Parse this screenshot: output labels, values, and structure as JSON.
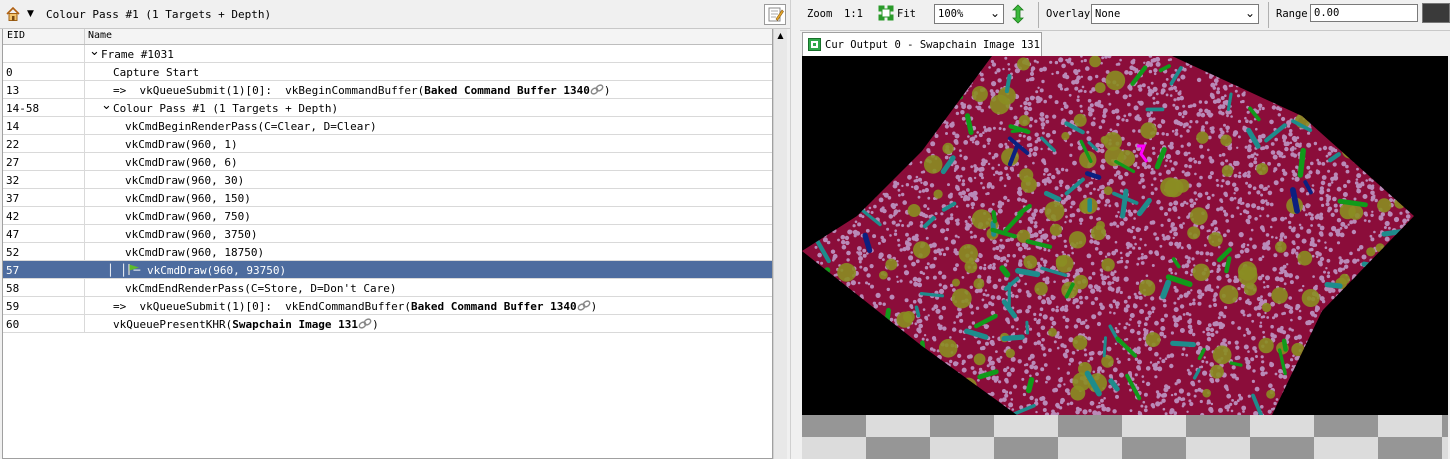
{
  "event_browser": {
    "title": "Colour Pass #1 (1 Targets + Depth)",
    "columns": {
      "eid": "EID",
      "name": "Name"
    },
    "rows": [
      {
        "eid": "",
        "name": "Frame #1031",
        "indent": 98,
        "chevron": true
      },
      {
        "eid": "0",
        "name": "Capture Start",
        "indent": 110
      },
      {
        "eid": "13",
        "name": "=>  vkQueueSubmit(1)[0]:  vkBeginCommandBuffer(",
        "bold": "Baked Command Buffer 1340",
        "tail": ")",
        "indent": 110,
        "link": true
      },
      {
        "eid": "14-58",
        "name": "Colour Pass #1 (1 Targets + Depth)",
        "indent": 110,
        "chevron": true
      },
      {
        "eid": "14",
        "name": "vkCmdBeginRenderPass(C=Clear, D=Clear)",
        "indent": 122
      },
      {
        "eid": "22",
        "name": "vkCmdDraw(960, 1)",
        "indent": 122
      },
      {
        "eid": "27",
        "name": "vkCmdDraw(960, 6)",
        "indent": 122
      },
      {
        "eid": "32",
        "name": "vkCmdDraw(960, 30)",
        "indent": 122
      },
      {
        "eid": "37",
        "name": "vkCmdDraw(960, 150)",
        "indent": 122
      },
      {
        "eid": "42",
        "name": "vkCmdDraw(960, 750)",
        "indent": 122
      },
      {
        "eid": "47",
        "name": "vkCmdDraw(960, 3750)",
        "indent": 122
      },
      {
        "eid": "52",
        "name": "vkCmdDraw(960, 18750)",
        "indent": 122
      },
      {
        "eid": "57",
        "name": "vkCmdDraw(960, 93750)",
        "indent": 144,
        "selected": true,
        "flag": true
      },
      {
        "eid": "58",
        "name": "vkCmdEndRenderPass(C=Store, D=Don't Care)",
        "indent": 122
      },
      {
        "eid": "59",
        "name": "=>  vkQueueSubmit(1)[0]:  vkEndCommandBuffer(",
        "bold": "Baked Command Buffer 1340",
        "tail": ")",
        "indent": 110,
        "link": true
      },
      {
        "eid": "60",
        "name": "vkQueuePresentKHR(",
        "bold": "Swapchain Image 131",
        "tail": ")",
        "indent": 110,
        "link": true
      }
    ]
  },
  "texture_viewer": {
    "zoom_label": "Zoom",
    "zoom_ratio": "1:1",
    "fit_label": "Fit",
    "zoom_value": "100%",
    "overlay_label": "Overlay",
    "overlay_value": "None",
    "range_label": "Range",
    "range_value": "0.00",
    "tab_title": "Cur Output 0 - Swapchain Image 131"
  },
  "colors": {
    "selection": "#4d6c9f",
    "render_base": "#8b0d3a",
    "render_dots": "#b98ab8",
    "render_olive": "#8a8d22",
    "render_teal": "#1e8c8c",
    "render_green": "#119a1a",
    "render_blue": "#0c2080",
    "render_magenta": "#ff00ff"
  },
  "icons": [
    "home-icon",
    "chevron-down-icon",
    "bookmark-icon",
    "link-icon",
    "flag-icon",
    "fit-icon",
    "flip-icon",
    "texture-icon",
    "expand-icon"
  ]
}
